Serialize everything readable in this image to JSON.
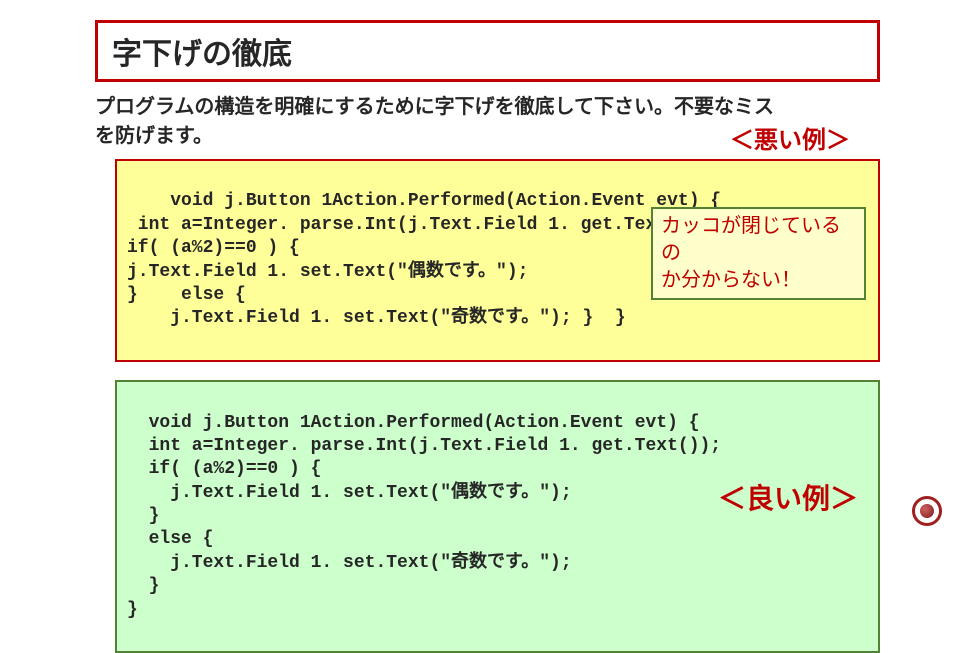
{
  "title": "字下げの徹底",
  "body_line1": "プログラムの構造を明確にするために字下げを徹底して下さい。不要なミス",
  "body_line2": "を防げます。",
  "bad_label": "＜悪い例＞",
  "good_label": "＜良い例＞",
  "callout_line1": "カッコが閉じているの",
  "callout_line2": "か分からない！",
  "bad_code": "  void j.Button 1Action.Performed(Action.Event evt) {\n int a=Integer. parse.Int(j.Text.Field 1. get.Text());\nif( (a%2)==0 ) {\nj.Text.Field 1. set.Text(\"偶数です。\");\n}    else {\n    j.Text.Field 1. set.Text(\"奇数です。\"); }  }",
  "good_code": "void j.Button 1Action.Performed(Action.Event evt) {\n  int a=Integer. parse.Int(j.Text.Field 1. get.Text());\n  if( (a%2)==0 ) {\n    j.Text.Field 1. set.Text(\"偶数です。\");\n  }\n  else {\n    j.Text.Field 1. set.Text(\"奇数です。\");\n  }\n}"
}
